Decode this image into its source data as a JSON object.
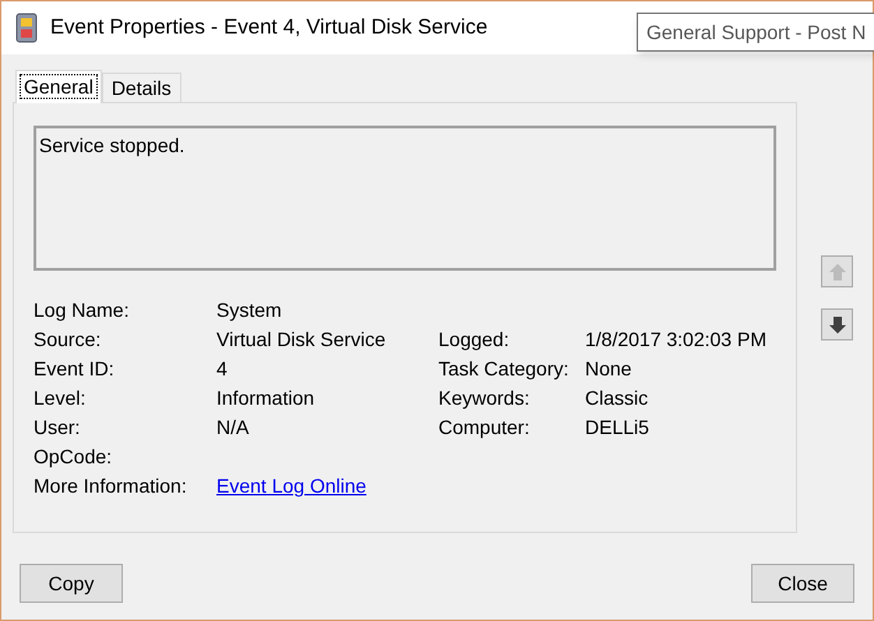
{
  "window": {
    "title": "Event Properties - Event 4, Virtual Disk Service"
  },
  "tooltip": {
    "text": "General Support - Post N"
  },
  "tabs": [
    {
      "label": "General",
      "selected": true
    },
    {
      "label": "Details",
      "selected": false
    }
  ],
  "description": "Service stopped.",
  "fields_left": [
    {
      "label": "Log Name:",
      "value": "System"
    },
    {
      "label": "Source:",
      "value": "Virtual Disk Service"
    },
    {
      "label": "Event ID:",
      "value": "4"
    },
    {
      "label": "Level:",
      "value": "Information"
    },
    {
      "label": "User:",
      "value": "N/A"
    },
    {
      "label": "OpCode:"
    }
  ],
  "fields_right": [
    {
      "label": "Logged:",
      "value": "1/8/2017 3:02:03 PM"
    },
    {
      "label": "Task Category:",
      "value": "None"
    },
    {
      "label": "Keywords:",
      "value": "Classic"
    },
    {
      "label": "Computer:",
      "value": "DELLi5"
    }
  ],
  "more_information": {
    "label": "More Information:",
    "link": "Event Log Online"
  },
  "nav_buttons": [
    {
      "kind": "up",
      "disabled": true
    },
    {
      "kind": "down",
      "disabled": false
    }
  ],
  "buttons": [
    "Copy",
    "Close"
  ]
}
